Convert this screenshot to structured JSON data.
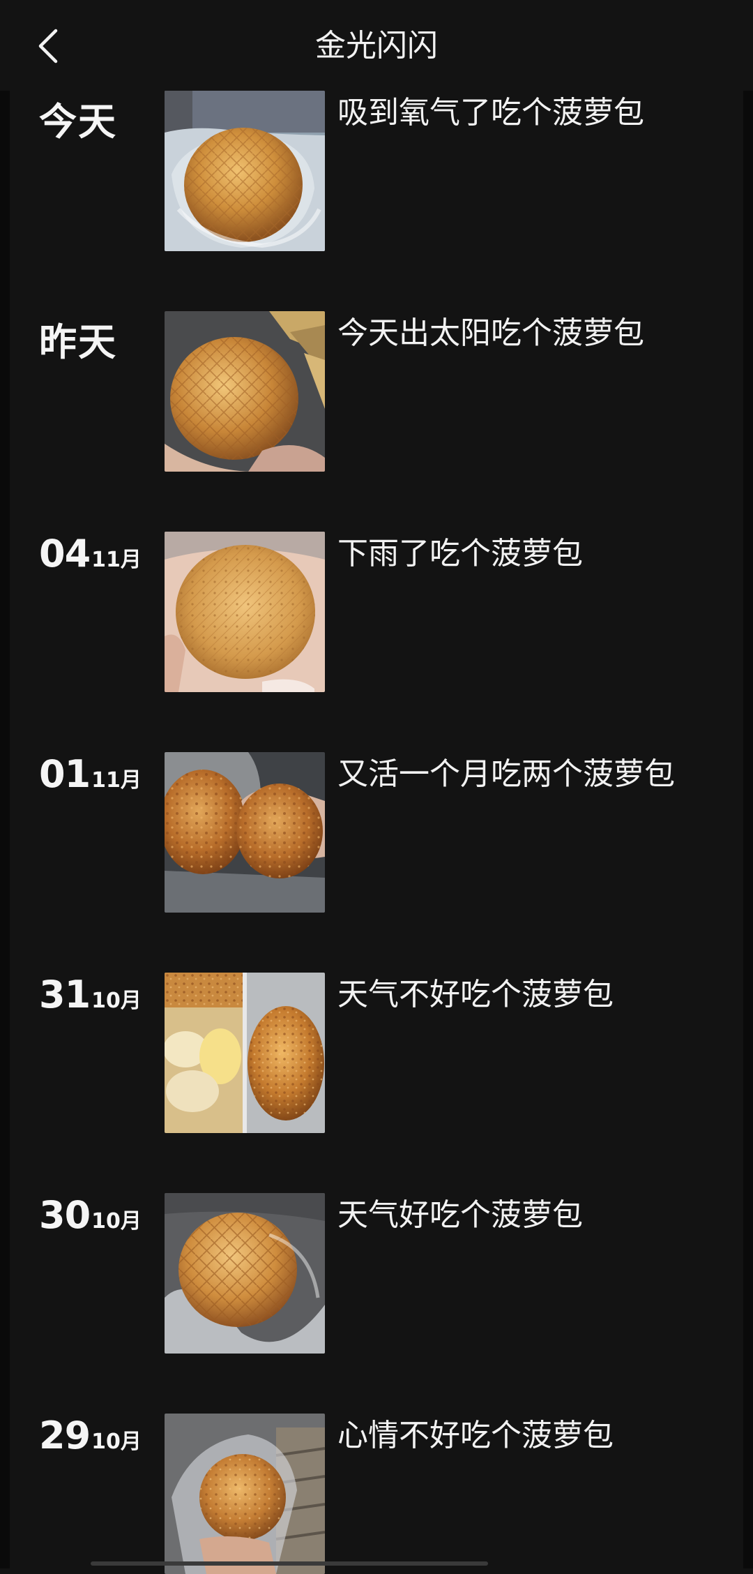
{
  "header": {
    "title": "金光闪闪"
  },
  "entries": [
    {
      "day_word": "今天",
      "day": "",
      "month": "",
      "caption": "吸到氧气了吃个菠萝包",
      "photo": "bun-in-plastic-bag"
    },
    {
      "day_word": "昨天",
      "day": "",
      "month": "",
      "caption": "今天出太阳吃个菠萝包",
      "photo": "bun-in-hand"
    },
    {
      "day_word": "",
      "day": "04",
      "month": "11月",
      "caption": "下雨了吃个菠萝包",
      "photo": "bun-in-hand"
    },
    {
      "day_word": "",
      "day": "01",
      "month": "11月",
      "caption": "又活一个月吃两个菠萝包",
      "photo": "two-buns"
    },
    {
      "day_word": "",
      "day": "31",
      "month": "10月",
      "caption": "天气不好吃个菠萝包",
      "photo": "bun-split-collage"
    },
    {
      "day_word": "",
      "day": "30",
      "month": "10月",
      "caption": "天气好吃个菠萝包",
      "photo": "bun-in-plastic-bag"
    },
    {
      "day_word": "",
      "day": "29",
      "month": "10月",
      "caption": "心情不好吃个菠萝包",
      "photo": "bun-in-hand"
    }
  ],
  "icons": {
    "back": "chevron-left-icon"
  },
  "colors": {
    "background": "#131313",
    "text": "#f2f2f2",
    "bun_crust": "#c98a3a",
    "bun_highlight": "#e9b965"
  }
}
